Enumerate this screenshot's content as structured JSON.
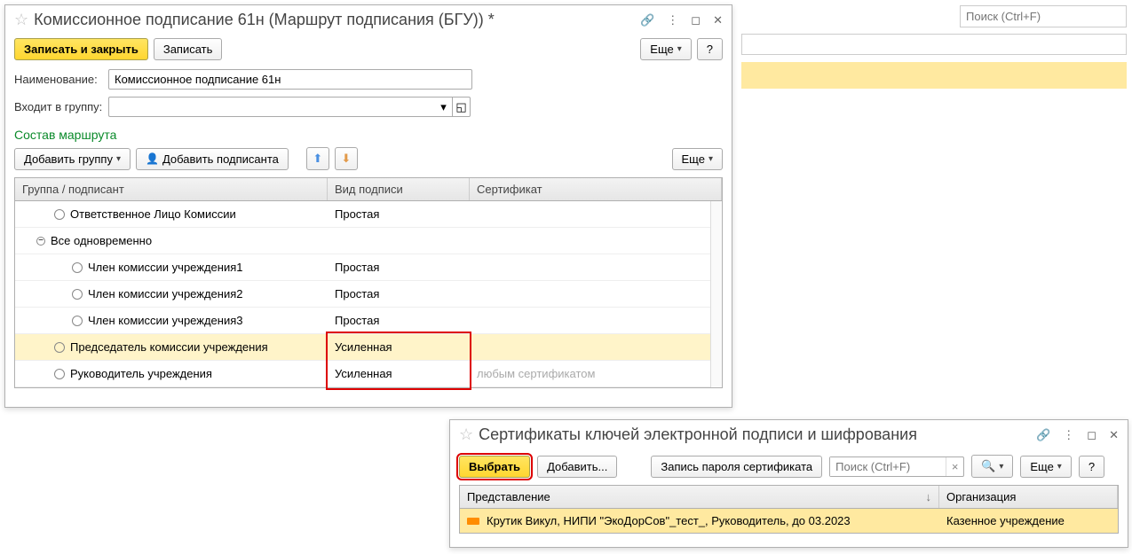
{
  "bg": {
    "search_placeholder": "Поиск (Ctrl+F)"
  },
  "win1": {
    "title": "Комиссионное подписание 61н (Маршрут подписания (БГУ)) *",
    "save_close_label": "Записать и закрыть",
    "save_label": "Записать",
    "more_label": "Еще",
    "help_label": "?",
    "name_field_label": "Наименование:",
    "name_field_value": "Комиссионное подписание 61н",
    "group_field_label": "Входит в группу:",
    "group_field_value": "",
    "route_section": "Состав маршрута",
    "add_group_label": "Добавить группу",
    "add_signer_label": "Добавить подписанта",
    "grid_headers": {
      "col1": "Группа / подписант",
      "col2": "Вид подписи",
      "col3": "Сертификат"
    },
    "rows": [
      {
        "level": 0,
        "icon": "circ",
        "label": "Ответственное Лицо Комиссии",
        "sign": "Простая",
        "cert": ""
      },
      {
        "level": 1,
        "icon": "toggle",
        "label": "Все одновременно",
        "sign": "",
        "cert": ""
      },
      {
        "level": 2,
        "icon": "circ",
        "label": "Член комиссии учреждения1",
        "sign": "Простая",
        "cert": ""
      },
      {
        "level": 2,
        "icon": "circ",
        "label": "Член комиссии учреждения2",
        "sign": "Простая",
        "cert": ""
      },
      {
        "level": 2,
        "icon": "circ",
        "label": "Член комиссии учреждения3",
        "sign": "Простая",
        "cert": ""
      },
      {
        "level": 0,
        "icon": "circ",
        "label": "Председатель комиссии учреждения",
        "sign": "Усиленная",
        "cert": "",
        "selected": true
      },
      {
        "level": 0,
        "icon": "circ",
        "label": "Руководитель учреждения",
        "sign": "Усиленная",
        "cert": "любым сертификатом",
        "cert_placeholder": true
      }
    ]
  },
  "win2": {
    "title": "Сертификаты ключей электронной подписи и шифрования",
    "select_label": "Выбрать",
    "add_label": "Добавить...",
    "pwd_label": "Запись пароля сертификата",
    "search_placeholder": "Поиск (Ctrl+F)",
    "more_label": "Еще",
    "help_label": "?",
    "headers": {
      "col1": "Представление",
      "col2": "Организация"
    },
    "row": {
      "repr": "Крутик Викул, НИПИ \"ЭкоДорСов\"_тест_, Руководитель, до 03.2023",
      "org": "Казенное учреждение"
    }
  }
}
